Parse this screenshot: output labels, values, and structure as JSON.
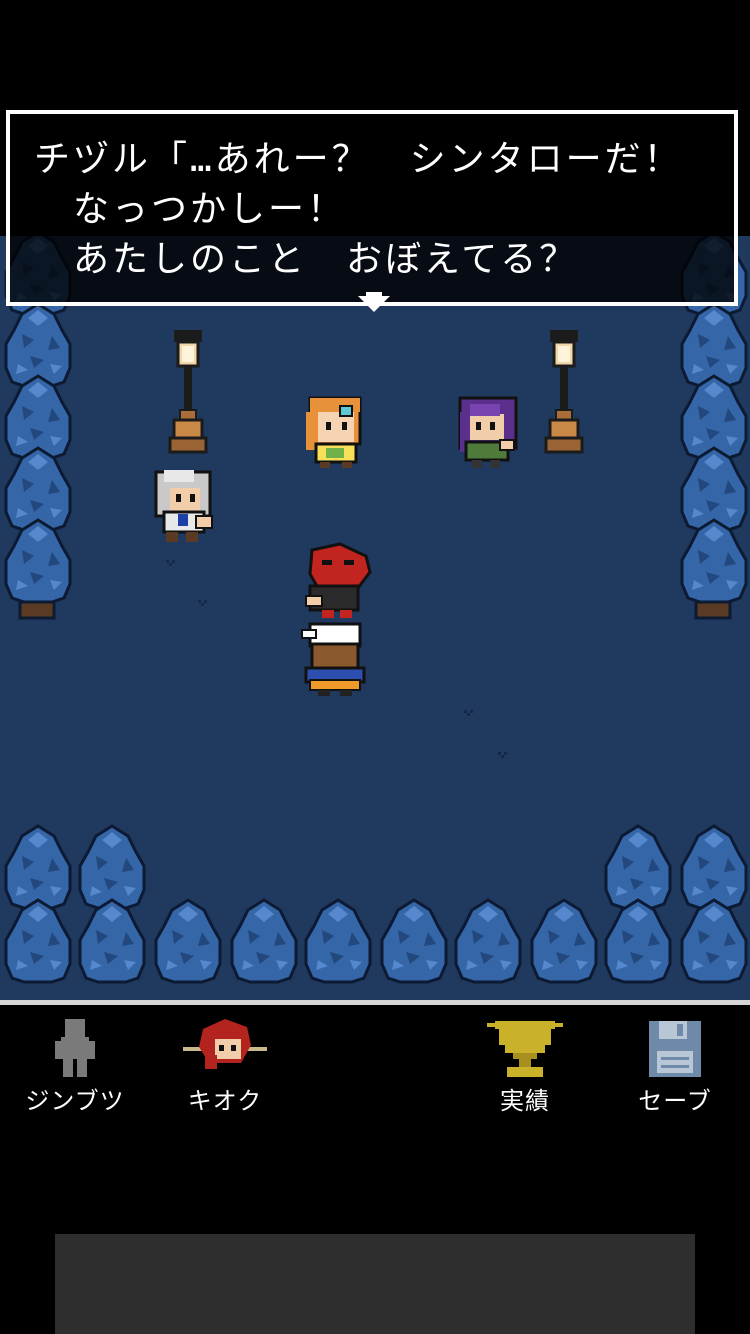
{
  "dialog": {
    "speaker_line": "チヅル「…あれー？　シンタローだ！",
    "line2": "　なっつかしー！",
    "line3": "　あたしのこと　おぼえてる？"
  },
  "menu": {
    "items": [
      {
        "label": "ジンブツ",
        "icon": "person-silhouette-icon"
      },
      {
        "label": "キオク",
        "icon": "memory-portrait-icon"
      },
      {
        "label": "実績",
        "icon": "trophy-icon"
      },
      {
        "label": "セーブ",
        "icon": "floppy-disk-icon"
      }
    ]
  },
  "colors": {
    "ground": "#20395e",
    "tree": "#3566a8",
    "trophy": "#c9b12a",
    "menu_divider": "#d6d6d6",
    "ad_banner": "#2e2e2e"
  }
}
